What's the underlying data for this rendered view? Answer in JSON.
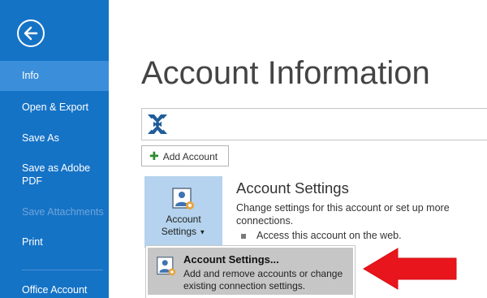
{
  "nav": {
    "items": [
      {
        "label": "Info",
        "selected": true,
        "disabled": false
      },
      {
        "label": "Open & Export",
        "selected": false,
        "disabled": false
      },
      {
        "label": "Save As",
        "selected": false,
        "disabled": false
      },
      {
        "label": "Save as Adobe PDF",
        "selected": false,
        "disabled": false
      },
      {
        "label": "Save Attachments",
        "selected": false,
        "disabled": true
      },
      {
        "label": "Print",
        "selected": false,
        "disabled": false
      },
      {
        "label": "Office Account",
        "selected": false,
        "disabled": false
      }
    ],
    "back_icon": "back-arrow-icon"
  },
  "main": {
    "title": "Account Information",
    "add_account_label": "Add Account",
    "account_tile": {
      "line1": "Account",
      "line2": "Settings"
    },
    "section": {
      "title": "Account Settings",
      "description": "Change settings for this account or set up more connections.",
      "bullet": "Access this account on the web."
    }
  },
  "dropdown": {
    "items": [
      {
        "title": "Account Settings...",
        "description": "Add and remove accounts or change existing connection settings."
      }
    ]
  },
  "colors": {
    "nav_bg": "#1573c6",
    "nav_selected": "#3b8fda",
    "tile_bg": "#b5d3ee",
    "annotation_arrow": "#e8151d"
  }
}
